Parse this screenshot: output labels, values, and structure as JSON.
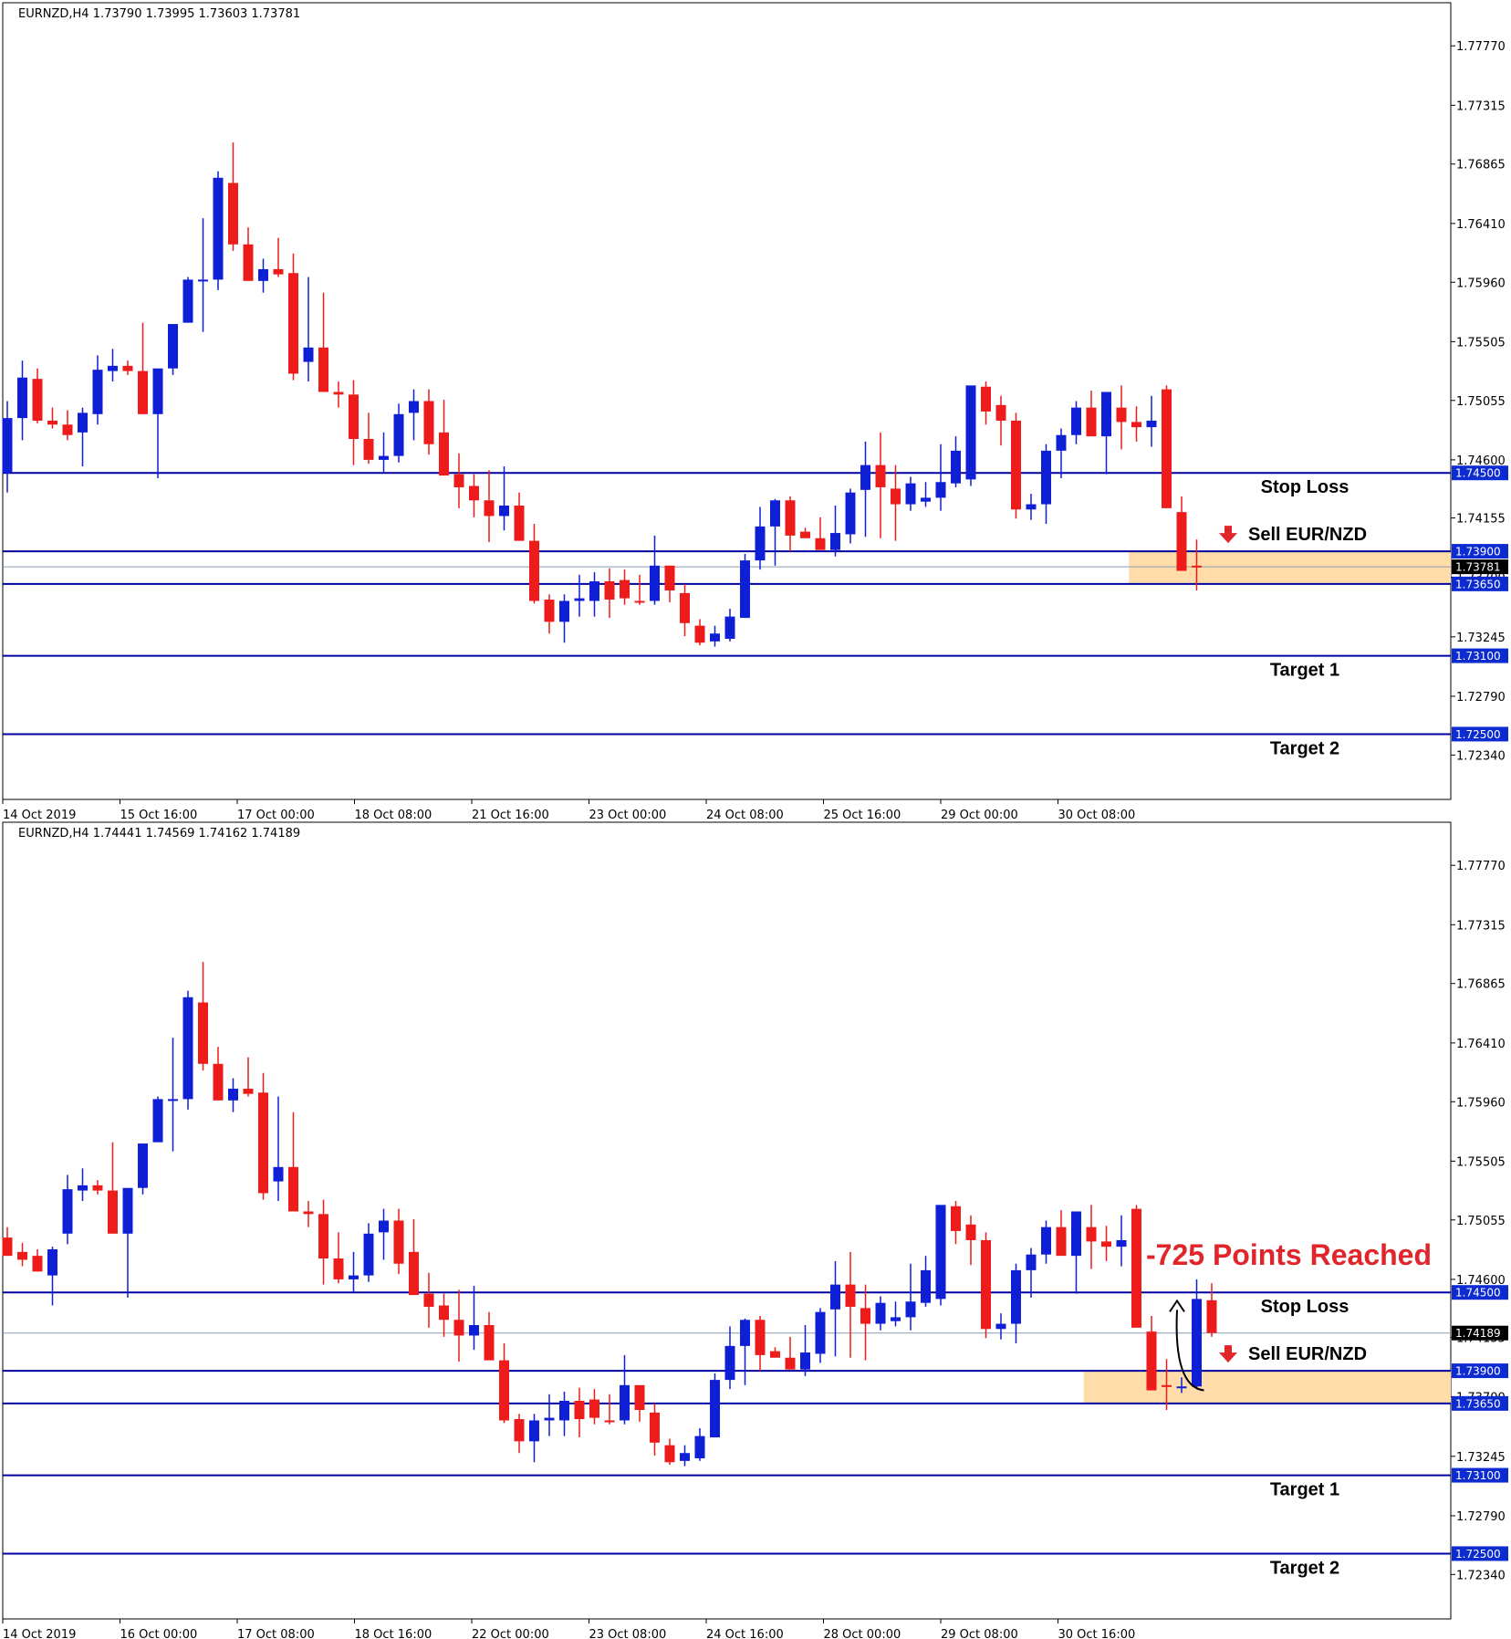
{
  "chart_data": [
    {
      "type": "candlestick",
      "title": "EURNZD,H4  1.73790 1.73995 1.73603 1.73781",
      "ylim": [
        1.72,
        1.781
      ],
      "y_ticks": [
        "1.77770",
        "1.77315",
        "1.76865",
        "1.76410",
        "1.75960",
        "1.75505",
        "1.75055",
        "1.74600",
        "1.74155",
        "1.73700",
        "1.73245",
        "1.72790",
        "1.72340"
      ],
      "hidden_ticks": [
        1.737
      ],
      "x_labels": [
        "14 Oct 2019",
        "15 Oct 16:00",
        "17 Oct 00:00",
        "18 Oct 08:00",
        "21 Oct 16:00",
        "23 Oct 00:00",
        "24 Oct 08:00",
        "25 Oct 16:00",
        "29 Oct 00:00",
        "30 Oct 08:00"
      ],
      "levels": [
        {
          "value": 1.745,
          "label": "1.74500",
          "annotation": "Stop Loss"
        },
        {
          "value": 1.739,
          "label": "1.73900",
          "annotation": "Sell EUR/NZD",
          "arrow": true
        },
        {
          "value": 1.7365,
          "label": "1.73650",
          "annotation": ""
        },
        {
          "value": 1.731,
          "label": "1.73100",
          "annotation": "Target 1"
        },
        {
          "value": 1.725,
          "label": "1.72500",
          "annotation": "Target 2"
        }
      ],
      "current_price": {
        "value": 1.73781,
        "label": "1.73781"
      },
      "zone": {
        "from": 1.7365,
        "to": 1.739,
        "color": "#ffdcaa",
        "start_candle": 75
      },
      "headline": "",
      "colors": {
        "bull": "#0f1fd6",
        "bear": "#ee1b1b",
        "level_line": "#0000a0",
        "label_bg": "#0c2bd0"
      },
      "candles": [
        [
          1.745,
          1.7505,
          1.7435,
          1.7492
        ],
        [
          1.7492,
          1.7536,
          1.7475,
          1.7523
        ],
        [
          1.7522,
          1.753,
          1.7488,
          1.749
        ],
        [
          1.749,
          1.75,
          1.7484,
          1.7487
        ],
        [
          1.7487,
          1.7498,
          1.7475,
          1.7479
        ],
        [
          1.7481,
          1.75,
          1.7455,
          1.7496
        ],
        [
          1.7495,
          1.754,
          1.7487,
          1.7529
        ],
        [
          1.7528,
          1.7545,
          1.752,
          1.7532
        ],
        [
          1.7532,
          1.7536,
          1.7525,
          1.7528
        ],
        [
          1.7528,
          1.7565,
          1.7495,
          1.7495
        ],
        [
          1.7495,
          1.7515,
          1.7446,
          1.753
        ],
        [
          1.753,
          1.755,
          1.7525,
          1.7564
        ],
        [
          1.7565,
          1.76,
          1.7565,
          1.7598
        ],
        [
          1.7598,
          1.7645,
          1.7558,
          1.7598
        ],
        [
          1.7598,
          1.7681,
          1.759,
          1.7676
        ],
        [
          1.7672,
          1.7703,
          1.762,
          1.7625
        ],
        [
          1.7625,
          1.7638,
          1.7597,
          1.7597
        ],
        [
          1.7597,
          1.7614,
          1.7588,
          1.7606
        ],
        [
          1.7606,
          1.763,
          1.76,
          1.7602
        ],
        [
          1.7603,
          1.7618,
          1.7521,
          1.7526
        ],
        [
          1.7535,
          1.76,
          1.752,
          1.7546
        ],
        [
          1.7546,
          1.7588,
          1.7516,
          1.7512
        ],
        [
          1.7512,
          1.752,
          1.75,
          1.751
        ],
        [
          1.751,
          1.7521,
          1.7456,
          1.7476
        ],
        [
          1.7476,
          1.7496,
          1.7457,
          1.746
        ],
        [
          1.746,
          1.7481,
          1.745,
          1.7463
        ],
        [
          1.7463,
          1.7503,
          1.7458,
          1.7495
        ],
        [
          1.7496,
          1.7514,
          1.7475,
          1.7505
        ],
        [
          1.7505,
          1.7514,
          1.7464,
          1.7472
        ],
        [
          1.7481,
          1.7506,
          1.7448,
          1.7448
        ],
        [
          1.7449,
          1.7465,
          1.7423,
          1.7439
        ],
        [
          1.744,
          1.7449,
          1.7416,
          1.7429
        ],
        [
          1.7429,
          1.7452,
          1.7397,
          1.7417
        ],
        [
          1.7417,
          1.7455,
          1.7406,
          1.7425
        ],
        [
          1.7425,
          1.7435,
          1.7398,
          1.7398
        ],
        [
          1.7398,
          1.7411,
          1.735,
          1.7352
        ],
        [
          1.7353,
          1.7357,
          1.7327,
          1.7336
        ],
        [
          1.7336,
          1.7357,
          1.732,
          1.7352
        ],
        [
          1.7352,
          1.7372,
          1.734,
          1.7354
        ],
        [
          1.7352,
          1.7374,
          1.734,
          1.7367
        ],
        [
          1.7367,
          1.7377,
          1.7339,
          1.7353
        ],
        [
          1.7368,
          1.7376,
          1.7349,
          1.7354
        ],
        [
          1.7352,
          1.7372,
          1.7349,
          1.7351
        ],
        [
          1.7352,
          1.7402,
          1.7349,
          1.7379
        ],
        [
          1.7379,
          1.7379,
          1.7351,
          1.736
        ],
        [
          1.7358,
          1.7365,
          1.7325,
          1.7335
        ],
        [
          1.7333,
          1.7338,
          1.7318,
          1.732
        ],
        [
          1.7321,
          1.7333,
          1.7317,
          1.7327
        ],
        [
          1.7323,
          1.7346,
          1.7321,
          1.734
        ],
        [
          1.7339,
          1.7388,
          1.7339,
          1.7383
        ],
        [
          1.7383,
          1.7424,
          1.7376,
          1.7409
        ],
        [
          1.7409,
          1.743,
          1.7379,
          1.7429
        ],
        [
          1.7429,
          1.7432,
          1.739,
          1.7402
        ],
        [
          1.7405,
          1.7408,
          1.7402,
          1.74
        ],
        [
          1.74,
          1.7416,
          1.7391,
          1.7391
        ],
        [
          1.7391,
          1.7425,
          1.7386,
          1.7404
        ],
        [
          1.7403,
          1.7438,
          1.7396,
          1.7435
        ],
        [
          1.7437,
          1.7474,
          1.7401,
          1.7456
        ],
        [
          1.7456,
          1.7481,
          1.74,
          1.7439
        ],
        [
          1.7438,
          1.7456,
          1.7398,
          1.7426
        ],
        [
          1.7426,
          1.7447,
          1.7421,
          1.7442
        ],
        [
          1.7428,
          1.7443,
          1.7424,
          1.7431
        ],
        [
          1.7431,
          1.7472,
          1.7421,
          1.7443
        ],
        [
          1.7442,
          1.7478,
          1.7439,
          1.7467
        ],
        [
          1.7445,
          1.749,
          1.744,
          1.7517
        ],
        [
          1.7516,
          1.752,
          1.7487,
          1.7497
        ],
        [
          1.7502,
          1.7509,
          1.7471,
          1.749
        ],
        [
          1.749,
          1.7496,
          1.7415,
          1.7422
        ],
        [
          1.7422,
          1.7434,
          1.7414,
          1.7426
        ],
        [
          1.7426,
          1.7472,
          1.7411,
          1.7467
        ],
        [
          1.7467,
          1.7484,
          1.7446,
          1.7479
        ],
        [
          1.7479,
          1.7505,
          1.7472,
          1.75
        ],
        [
          1.75,
          1.7513,
          1.7483,
          1.7478
        ],
        [
          1.7478,
          1.7502,
          1.7449,
          1.7512
        ],
        [
          1.75,
          1.7517,
          1.7468,
          1.7489
        ],
        [
          1.7489,
          1.7501,
          1.7474,
          1.7485
        ],
        [
          1.7485,
          1.7509,
          1.747,
          1.749
        ],
        [
          1.7514,
          1.7517,
          1.7423,
          1.7423
        ],
        [
          1.742,
          1.7432,
          1.7375,
          1.7375
        ],
        [
          1.7379,
          1.7399,
          1.736,
          1.7378
        ]
      ]
    },
    {
      "type": "candlestick",
      "title": "EURNZD,H4  1.74441 1.74569 1.74162 1.74189",
      "ylim": [
        1.72,
        1.781
      ],
      "y_ticks": [
        "1.77770",
        "1.77315",
        "1.76865",
        "1.76410",
        "1.75960",
        "1.75505",
        "1.75055",
        "1.74600",
        "1.74155",
        "1.73700",
        "1.73245",
        "1.72790",
        "1.72340"
      ],
      "hidden_ticks": [
        1.7415,
        1.737
      ],
      "x_labels": [
        "14 Oct 2019",
        "16 Oct 00:00",
        "17 Oct 08:00",
        "18 Oct 16:00",
        "22 Oct 00:00",
        "23 Oct 08:00",
        "24 Oct 16:00",
        "28 Oct 00:00",
        "29 Oct 08:00",
        "30 Oct 16:00"
      ],
      "levels": [
        {
          "value": 1.745,
          "label": "1.74500",
          "annotation": "Stop Loss"
        },
        {
          "value": 1.739,
          "label": "1.73900",
          "annotation": "Sell EUR/NZD",
          "arrow": true
        },
        {
          "value": 1.7365,
          "label": "1.73650",
          "annotation": ""
        },
        {
          "value": 1.731,
          "label": "1.73100",
          "annotation": "Target 1"
        },
        {
          "value": 1.725,
          "label": "1.72500",
          "annotation": "Target 2"
        }
      ],
      "current_price": {
        "value": 1.74189,
        "label": "1.74189"
      },
      "zone": {
        "from": 1.7365,
        "to": 1.739,
        "color": "#ffdcaa",
        "start_candle": 72
      },
      "headline": "-725 Points Reached",
      "colors": {
        "bull": "#0f1fd6",
        "bear": "#ee1b1b",
        "level_line": "#0000a0",
        "label_bg": "#0c2bd0"
      },
      "candles": [
        [
          1.7492,
          1.75,
          1.7478,
          1.7478
        ],
        [
          1.7481,
          1.7488,
          1.747,
          1.7475
        ],
        [
          1.7478,
          1.7483,
          1.7466,
          1.7466
        ],
        [
          1.7463,
          1.7485,
          1.744,
          1.7483
        ],
        [
          1.7495,
          1.754,
          1.7487,
          1.7529
        ],
        [
          1.7528,
          1.7545,
          1.752,
          1.7532
        ],
        [
          1.7532,
          1.7536,
          1.7525,
          1.7528
        ],
        [
          1.7528,
          1.7565,
          1.7495,
          1.7495
        ],
        [
          1.7495,
          1.7515,
          1.7446,
          1.753
        ],
        [
          1.753,
          1.755,
          1.7525,
          1.7564
        ],
        [
          1.7565,
          1.76,
          1.7565,
          1.7598
        ],
        [
          1.7598,
          1.7645,
          1.7558,
          1.7598
        ],
        [
          1.7598,
          1.7681,
          1.759,
          1.7676
        ],
        [
          1.7672,
          1.7703,
          1.762,
          1.7625
        ],
        [
          1.7625,
          1.7638,
          1.7597,
          1.7597
        ],
        [
          1.7597,
          1.7614,
          1.7588,
          1.7606
        ],
        [
          1.7606,
          1.763,
          1.76,
          1.7602
        ],
        [
          1.7603,
          1.7618,
          1.7521,
          1.7526
        ],
        [
          1.7535,
          1.76,
          1.752,
          1.7546
        ],
        [
          1.7546,
          1.7588,
          1.7516,
          1.7512
        ],
        [
          1.7512,
          1.752,
          1.75,
          1.751
        ],
        [
          1.751,
          1.7521,
          1.7456,
          1.7476
        ],
        [
          1.7476,
          1.7496,
          1.7457,
          1.746
        ],
        [
          1.746,
          1.7481,
          1.745,
          1.7463
        ],
        [
          1.7463,
          1.7503,
          1.7458,
          1.7495
        ],
        [
          1.7496,
          1.7514,
          1.7475,
          1.7505
        ],
        [
          1.7505,
          1.7514,
          1.7464,
          1.7472
        ],
        [
          1.7481,
          1.7506,
          1.7448,
          1.7448
        ],
        [
          1.7449,
          1.7465,
          1.7423,
          1.7439
        ],
        [
          1.744,
          1.7449,
          1.7416,
          1.7429
        ],
        [
          1.7429,
          1.7452,
          1.7397,
          1.7417
        ],
        [
          1.7417,
          1.7455,
          1.7406,
          1.7425
        ],
        [
          1.7425,
          1.7435,
          1.7398,
          1.7398
        ],
        [
          1.7398,
          1.7411,
          1.735,
          1.7352
        ],
        [
          1.7353,
          1.7357,
          1.7327,
          1.7336
        ],
        [
          1.7336,
          1.7357,
          1.732,
          1.7352
        ],
        [
          1.7352,
          1.7372,
          1.734,
          1.7354
        ],
        [
          1.7352,
          1.7374,
          1.734,
          1.7367
        ],
        [
          1.7367,
          1.7377,
          1.7339,
          1.7353
        ],
        [
          1.7368,
          1.7376,
          1.7349,
          1.7354
        ],
        [
          1.7352,
          1.7372,
          1.7349,
          1.7351
        ],
        [
          1.7352,
          1.7402,
          1.7349,
          1.7379
        ],
        [
          1.7379,
          1.7379,
          1.7351,
          1.736
        ],
        [
          1.7358,
          1.7365,
          1.7325,
          1.7335
        ],
        [
          1.7333,
          1.7338,
          1.7318,
          1.732
        ],
        [
          1.7321,
          1.7333,
          1.7317,
          1.7327
        ],
        [
          1.7323,
          1.7346,
          1.7321,
          1.734
        ],
        [
          1.7339,
          1.7388,
          1.7339,
          1.7383
        ],
        [
          1.7383,
          1.7424,
          1.7376,
          1.7409
        ],
        [
          1.7409,
          1.743,
          1.7379,
          1.7429
        ],
        [
          1.7429,
          1.7432,
          1.739,
          1.7402
        ],
        [
          1.7405,
          1.7408,
          1.7402,
          1.74
        ],
        [
          1.74,
          1.7416,
          1.7391,
          1.7391
        ],
        [
          1.7391,
          1.7425,
          1.7386,
          1.7404
        ],
        [
          1.7403,
          1.7438,
          1.7396,
          1.7435
        ],
        [
          1.7437,
          1.7474,
          1.7401,
          1.7456
        ],
        [
          1.7456,
          1.7481,
          1.74,
          1.7439
        ],
        [
          1.7438,
          1.7456,
          1.7398,
          1.7426
        ],
        [
          1.7426,
          1.7447,
          1.7421,
          1.7442
        ],
        [
          1.7428,
          1.7443,
          1.7424,
          1.7431
        ],
        [
          1.7431,
          1.7472,
          1.7421,
          1.7443
        ],
        [
          1.7442,
          1.7478,
          1.7439,
          1.7467
        ],
        [
          1.7445,
          1.749,
          1.744,
          1.7517
        ],
        [
          1.7516,
          1.752,
          1.7487,
          1.7497
        ],
        [
          1.7502,
          1.7509,
          1.7471,
          1.749
        ],
        [
          1.749,
          1.7496,
          1.7415,
          1.7422
        ],
        [
          1.7422,
          1.7434,
          1.7414,
          1.7426
        ],
        [
          1.7426,
          1.7472,
          1.7411,
          1.7467
        ],
        [
          1.7467,
          1.7484,
          1.7446,
          1.7479
        ],
        [
          1.7479,
          1.7505,
          1.7472,
          1.75
        ],
        [
          1.75,
          1.7513,
          1.7483,
          1.7478
        ],
        [
          1.7478,
          1.7502,
          1.7449,
          1.7512
        ],
        [
          1.75,
          1.7517,
          1.7468,
          1.7489
        ],
        [
          1.7489,
          1.7501,
          1.7474,
          1.7485
        ],
        [
          1.7485,
          1.7509,
          1.747,
          1.749
        ],
        [
          1.7514,
          1.7517,
          1.7423,
          1.7423
        ],
        [
          1.742,
          1.7432,
          1.7375,
          1.7375
        ],
        [
          1.7379,
          1.7399,
          1.736,
          1.7378
        ],
        [
          1.7378,
          1.7385,
          1.7373,
          1.7378
        ],
        [
          1.7378,
          1.746,
          1.7376,
          1.7445
        ],
        [
          1.7444,
          1.7457,
          1.7416,
          1.7419
        ]
      ]
    }
  ]
}
